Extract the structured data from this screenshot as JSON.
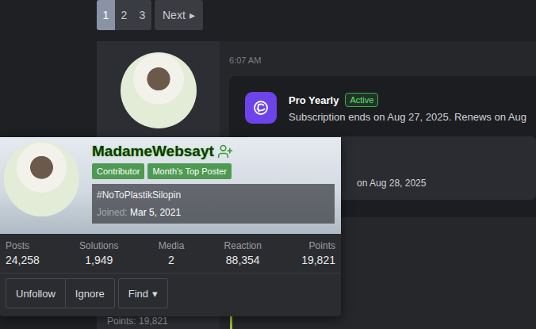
{
  "pagination": {
    "pages": [
      {
        "label": "1",
        "selected": true
      },
      {
        "label": "2",
        "selected": false
      },
      {
        "label": "3",
        "selected": false
      }
    ],
    "next": "Next",
    "next_icon": "▸"
  },
  "post": {
    "time": "6:07 AM",
    "subscription": {
      "title": "Pro Yearly",
      "status": "Active",
      "detail": "Subscription ends on Aug 27, 2025. Renews on Aug"
    },
    "second_detail": "on Aug 28, 2025",
    "author_points": "Points: 19,821"
  },
  "member_card": {
    "name": "MadameWebsayt",
    "badges": [
      "Contributor",
      "Month's Top Poster"
    ],
    "custom_title": "#NoToPlastikSilopin",
    "joined_label": "Joined:",
    "joined": "Mar 5, 2021",
    "stats": [
      {
        "label": "Posts",
        "value": "24,258"
      },
      {
        "label": "Solutions",
        "value": "1,949"
      },
      {
        "label": "Media",
        "value": "2"
      },
      {
        "label": "Reaction",
        "value": "88,354"
      },
      {
        "label": "Points",
        "value": "19,821"
      }
    ],
    "buttons": [
      {
        "label": "Unfollow",
        "group": true
      },
      {
        "label": "Ignore",
        "group": true
      },
      {
        "label": "Find",
        "group": false,
        "dropdown_icon": "▾"
      }
    ]
  }
}
